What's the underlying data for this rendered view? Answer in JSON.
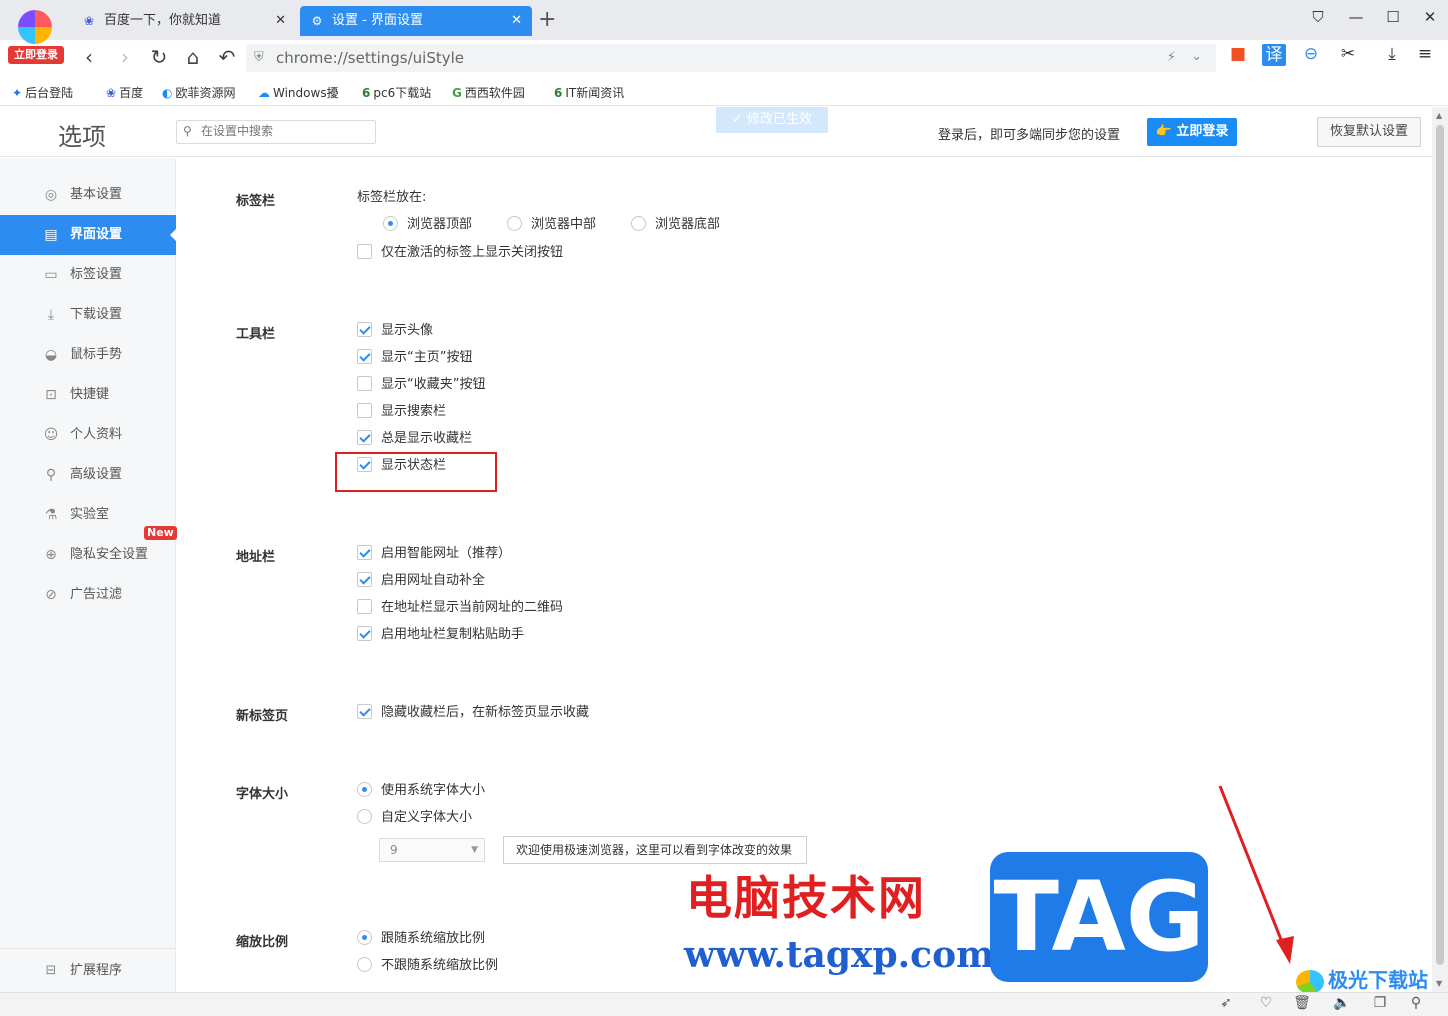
{
  "browser": {
    "login_badge": "立即登录",
    "tabs": [
      {
        "title": "百度一下，你就知道",
        "icon": "paw-icon",
        "active": false
      },
      {
        "title": "设置 - 界面设置",
        "icon": "gear-icon",
        "active": true
      }
    ],
    "new_tab": "+",
    "address": "chrome://settings/uiStyle",
    "translate": "译",
    "bookmarks": [
      {
        "label": "后台登陆",
        "icon": "✦"
      },
      {
        "label": "百度",
        "icon": "❀"
      },
      {
        "label": "欧菲资源网",
        "icon": "◐"
      },
      {
        "label": "Windows擾",
        "icon": "☁"
      },
      {
        "label": "pc6下载站",
        "icon": "6"
      },
      {
        "label": "西西软件园",
        "icon": "G"
      },
      {
        "label": "IT新闻资讯",
        "icon": "6"
      }
    ]
  },
  "header": {
    "title": "选项",
    "search_placeholder": "在设置中搜索",
    "toast": "✓ 修改已生效",
    "sync_text": "登录后，即可多端同步您的设置",
    "login_button": "👉 立即登录",
    "reset_button": "恢复默认设置"
  },
  "sidebar": {
    "items": [
      {
        "label": "基本设置",
        "icon": "◎"
      },
      {
        "label": "界面设置",
        "icon": "▤",
        "active": true
      },
      {
        "label": "标签设置",
        "icon": "▭"
      },
      {
        "label": "下载设置",
        "icon": "⤓"
      },
      {
        "label": "鼠标手势",
        "icon": "◒"
      },
      {
        "label": "快捷键",
        "icon": "⊡"
      },
      {
        "label": "个人资料",
        "icon": "☺"
      },
      {
        "label": "高级设置",
        "icon": "⚲"
      },
      {
        "label": "实验室",
        "icon": "⚗"
      },
      {
        "label": "隐私安全设置",
        "icon": "⊕"
      },
      {
        "label": "广告过滤",
        "icon": "⊘"
      }
    ],
    "new_badge": "New",
    "extensions": {
      "label": "扩展程序",
      "icon": "⊟"
    }
  },
  "sections": {
    "tabbar": {
      "title": "标签栏",
      "position_label": "标签栏放在:",
      "positions": [
        "浏览器顶部",
        "浏览器中部",
        "浏览器底部"
      ],
      "selected_position": 0,
      "close_on_active": {
        "label": "仅在激活的标签上显示关闭按钮",
        "checked": false
      }
    },
    "toolbar": {
      "title": "工具栏",
      "options": [
        {
          "label": "显示头像",
          "checked": true
        },
        {
          "label": "显示“主页”按钮",
          "checked": true
        },
        {
          "label": "显示“收藏夹”按钮",
          "checked": false
        },
        {
          "label": "显示搜索栏",
          "checked": false
        },
        {
          "label": "总是显示收藏栏",
          "checked": true
        },
        {
          "label": "显示状态栏",
          "checked": true
        }
      ]
    },
    "addressbar": {
      "title": "地址栏",
      "options": [
        {
          "label": "启用智能网址（推荐）",
          "checked": true
        },
        {
          "label": "启用网址自动补全",
          "checked": true
        },
        {
          "label": "在地址栏显示当前网址的二维码",
          "checked": false
        },
        {
          "label": "启用地址栏复制粘贴助手",
          "checked": true
        }
      ]
    },
    "newtab": {
      "title": "新标签页",
      "options": [
        {
          "label": "隐藏收藏栏后，在新标签页显示收藏",
          "checked": true
        }
      ]
    },
    "fontsize": {
      "title": "字体大小",
      "options": [
        {
          "label": "使用系统字体大小",
          "selected": true
        },
        {
          "label": "自定义字体大小",
          "selected": false
        }
      ],
      "size_value": "9",
      "preview_text": "欢迎使用极速浏览器，这里可以看到字体改变的效果"
    },
    "zoom": {
      "title": "缩放比例",
      "options": [
        {
          "label": "跟随系统缩放比例",
          "selected": true
        },
        {
          "label": "不跟随系统缩放比例",
          "selected": false
        }
      ]
    }
  },
  "watermarks": {
    "cn": "电脑技术网",
    "url": "www.tagxp.com",
    "tag": "TAG",
    "jg": "极光下载站"
  },
  "colors": {
    "accent": "#2d8cf0",
    "highlight_box": "#e02020"
  }
}
